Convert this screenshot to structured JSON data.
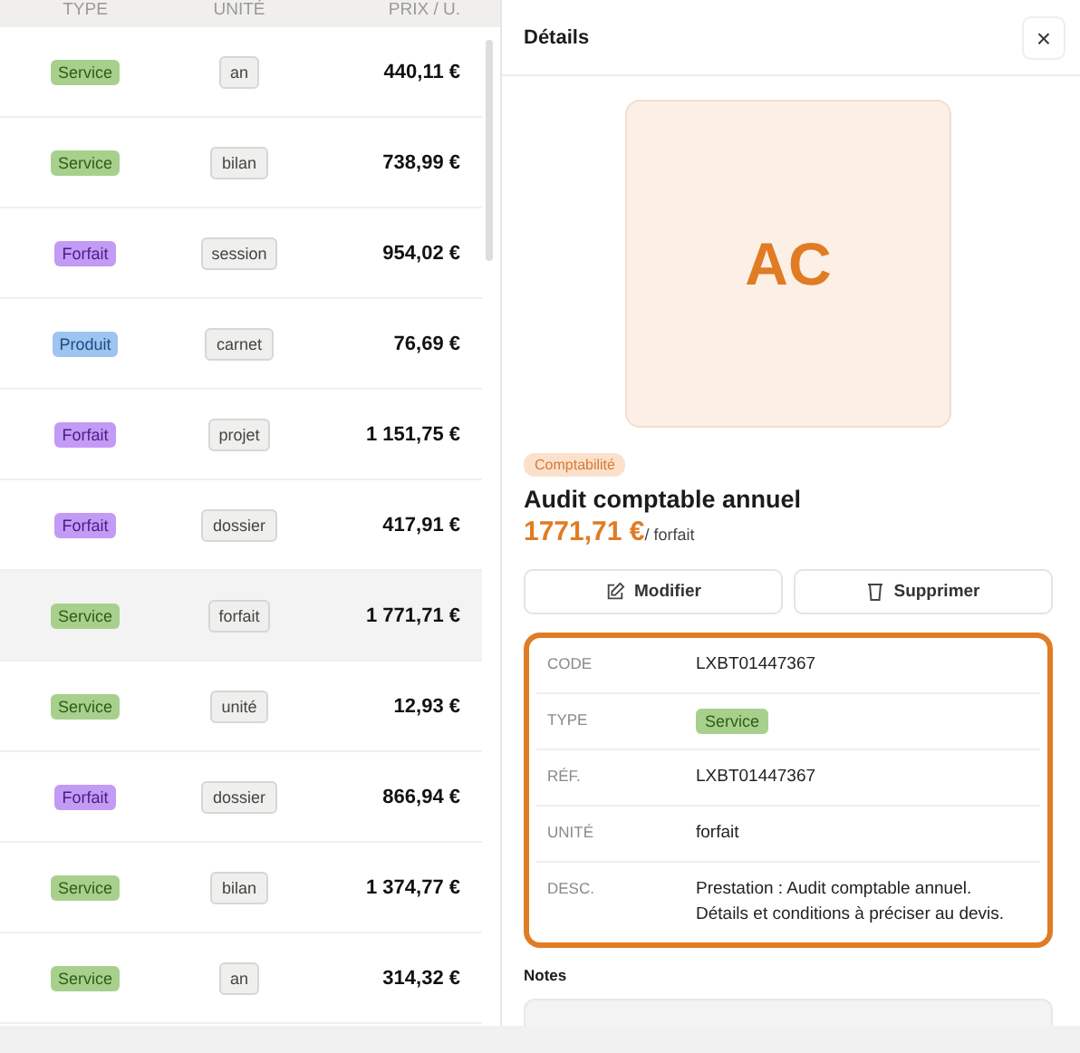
{
  "table": {
    "columns": [
      "TYPE",
      "UNITÉ",
      "PRIX / U."
    ],
    "rows": [
      {
        "type": {
          "label": "Service",
          "kind": "service"
        },
        "unit": "an",
        "price": "440,11 €",
        "selected": false
      },
      {
        "type": {
          "label": "Service",
          "kind": "service"
        },
        "unit": "bilan",
        "price": "738,99 €",
        "selected": false
      },
      {
        "type": {
          "label": "Forfait",
          "kind": "forfait"
        },
        "unit": "session",
        "price": "954,02 €",
        "selected": false
      },
      {
        "type": {
          "label": "Produit",
          "kind": "produit"
        },
        "unit": "carnet",
        "price": "76,69 €",
        "selected": false
      },
      {
        "type": {
          "label": "Forfait",
          "kind": "forfait"
        },
        "unit": "projet",
        "price": "1 151,75 €",
        "selected": false
      },
      {
        "type": {
          "label": "Forfait",
          "kind": "forfait"
        },
        "unit": "dossier",
        "price": "417,91 €",
        "selected": false
      },
      {
        "type": {
          "label": "Service",
          "kind": "service"
        },
        "unit": "forfait",
        "price": "1 771,71 €",
        "selected": true
      },
      {
        "type": {
          "label": "Service",
          "kind": "service"
        },
        "unit": "unité",
        "price": "12,93 €",
        "selected": false
      },
      {
        "type": {
          "label": "Forfait",
          "kind": "forfait"
        },
        "unit": "dossier",
        "price": "866,94 €",
        "selected": false
      },
      {
        "type": {
          "label": "Service",
          "kind": "service"
        },
        "unit": "bilan",
        "price": "1 374,77 €",
        "selected": false
      },
      {
        "type": {
          "label": "Service",
          "kind": "service"
        },
        "unit": "an",
        "price": "314,32 €",
        "selected": false
      }
    ]
  },
  "details": {
    "title": "Détails",
    "close": "×",
    "initials": "AC",
    "category": "Comptabilité",
    "name": "Audit comptable annuel",
    "price": "1771,71 €",
    "per": "/ forfait",
    "actions": [
      {
        "label": "Modifier",
        "kind": "edit"
      },
      {
        "label": "Supprimer",
        "kind": "delete"
      }
    ],
    "fields": [
      {
        "label": "CODE",
        "value": "LXBT01447367",
        "kind": "text"
      },
      {
        "label": "TYPE",
        "value": "Service",
        "kind": "service"
      },
      {
        "label": "RÉF.",
        "value": "LXBT01447367",
        "kind": "text"
      },
      {
        "label": "UNITÉ",
        "value": "forfait",
        "kind": "text"
      },
      {
        "label": "DESC.",
        "value": "Prestation : Audit comptable annuel. Détails et conditions à préciser au devis.",
        "kind": "text"
      }
    ],
    "notes_label": "Notes"
  }
}
